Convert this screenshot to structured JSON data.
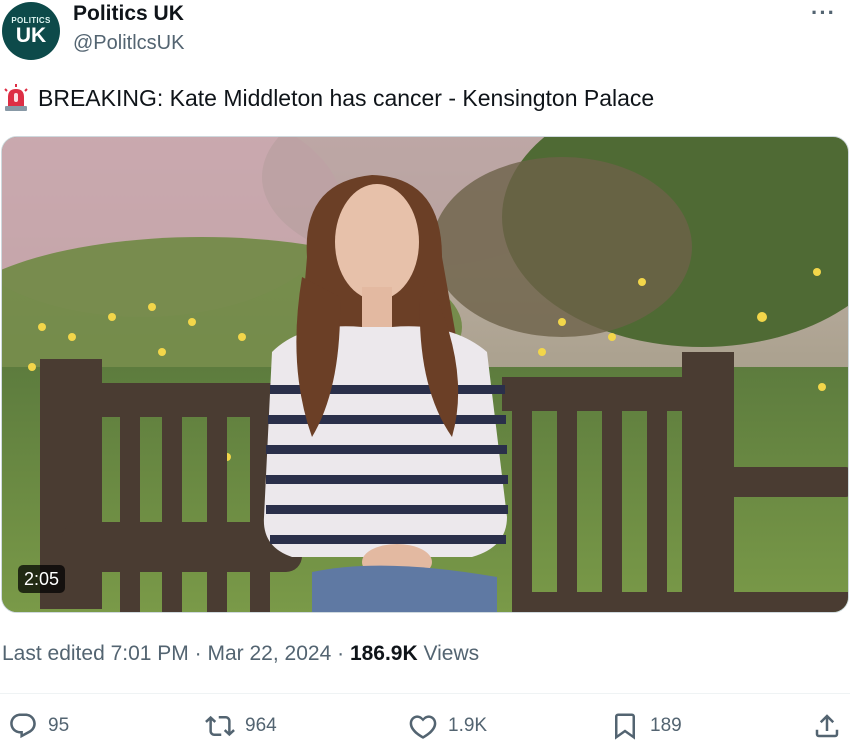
{
  "author": {
    "display_name": "Politics UK",
    "handle": "@PolitlcsUK",
    "avatar_text_top": "POLITICS",
    "avatar_text_main": "UK"
  },
  "tweet": {
    "emoji_icon": "police-siren-icon",
    "text": "BREAKING: Kate Middleton has cancer - Kensington Palace"
  },
  "media": {
    "type": "video",
    "duration": "2:05"
  },
  "meta": {
    "edited_label": "Last edited",
    "time": "7:01 PM",
    "separator": "·",
    "date": "Mar 22, 2024",
    "views_count": "186.9K",
    "views_label": "Views"
  },
  "actions": {
    "replies": "95",
    "reposts": "964",
    "likes": "1.9K",
    "bookmarks": "189"
  },
  "colors": {
    "text_primary": "#0f1419",
    "text_secondary": "#536471",
    "avatar_bg": "#0d4a4a"
  }
}
